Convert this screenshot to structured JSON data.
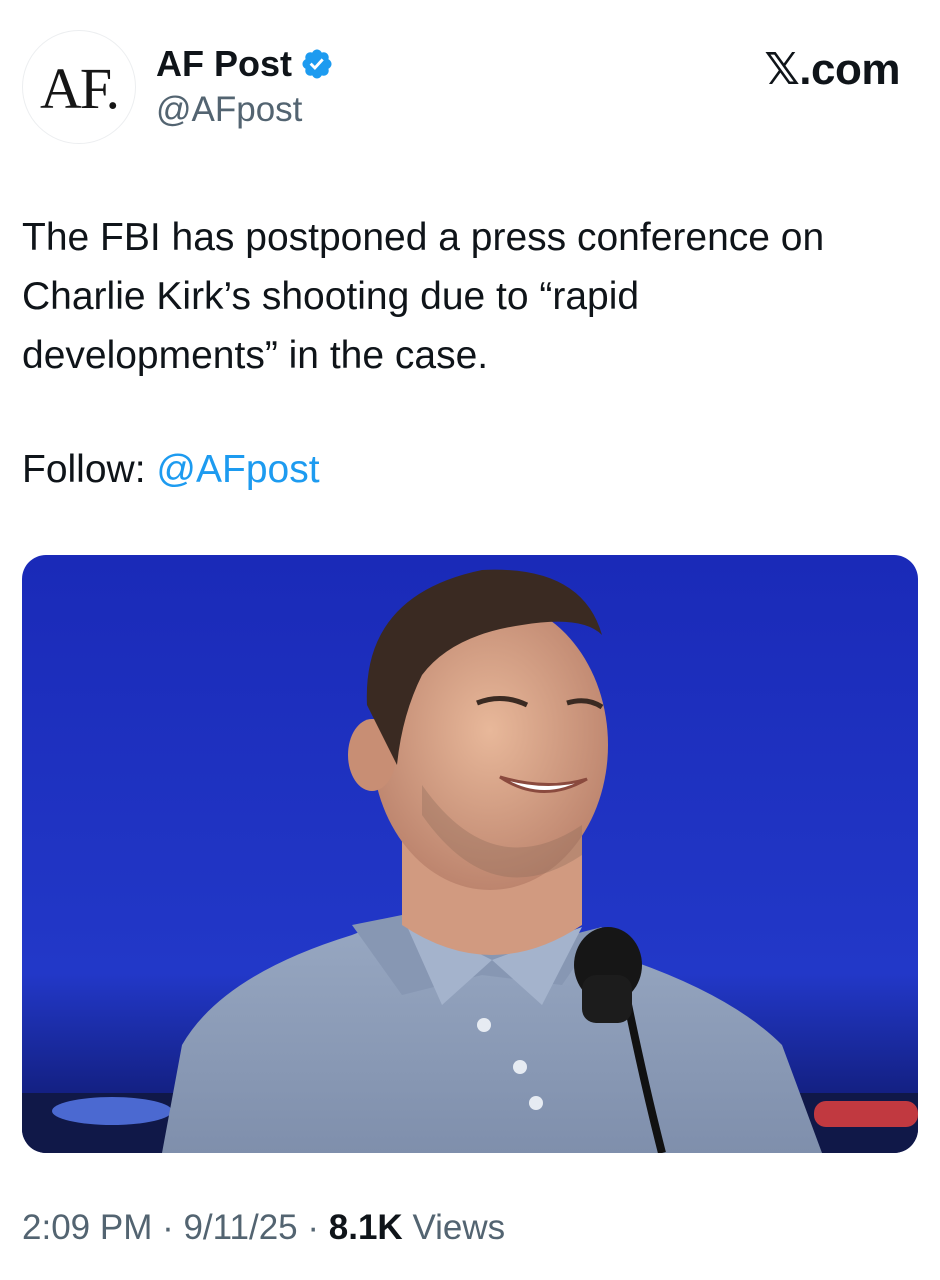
{
  "author": {
    "avatar_text": "AF.",
    "display_name": "AF Post",
    "handle": "@AFpost",
    "verified": true,
    "verified_color": "#1d9bf0"
  },
  "brand": "𝕏.com",
  "tweet": {
    "lines": [
      "The FBI has postponed a press conference on",
      "Charlie Kirk’s shooting due to “rapid",
      "developments” in the case."
    ],
    "follow_label": "Follow:",
    "follow_mention": "@AFpost",
    "mention_color": "#1d9bf0"
  },
  "media": {
    "icon": "photo-of-smiling-man-at-podium-microphone",
    "background_color": "#1b2bb8"
  },
  "meta": {
    "time": "2:09 PM",
    "separator": " · ",
    "date": "9/11/25",
    "views_count": "8.1K",
    "views_label": "Views"
  }
}
